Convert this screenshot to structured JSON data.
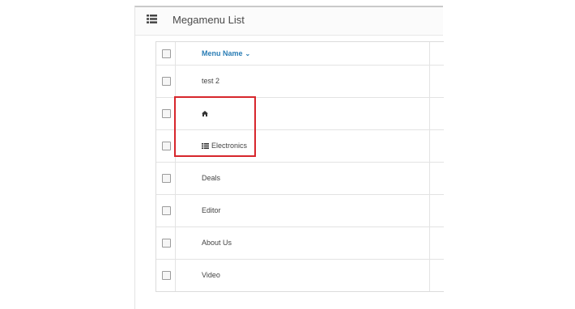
{
  "panel": {
    "title": "Megamenu List",
    "title_icon": "list-icon"
  },
  "table": {
    "header": {
      "label": "Menu Name",
      "sort_icon": "chevron-down-icon"
    },
    "rows": [
      {
        "label": "test 2",
        "icon": ""
      },
      {
        "label": "",
        "icon": "home-icon"
      },
      {
        "label": "Electronics",
        "icon": "list-icon"
      },
      {
        "label": "Deals",
        "icon": ""
      },
      {
        "label": "Editor",
        "icon": ""
      },
      {
        "label": "About Us",
        "icon": ""
      },
      {
        "label": "Video",
        "icon": ""
      }
    ]
  },
  "highlight_color": "#d7262c",
  "accent_color": "#2a7db5"
}
